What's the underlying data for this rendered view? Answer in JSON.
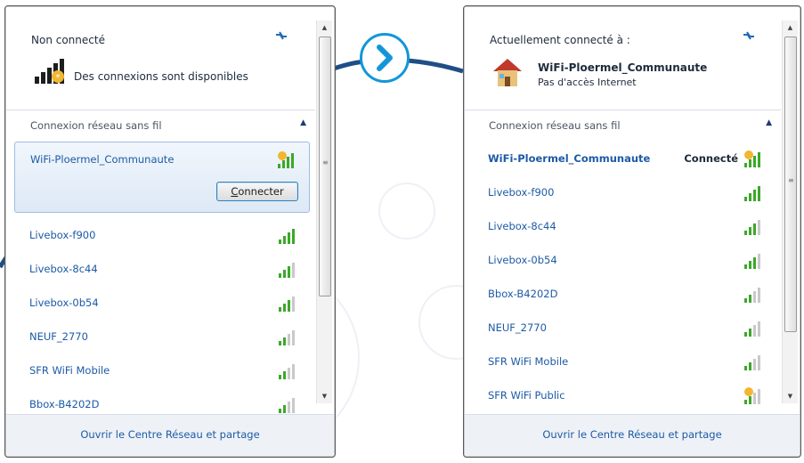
{
  "colors": {
    "accent": "#1396d8",
    "connector": "#1f4e86",
    "link": "#1d5aa6",
    "text": "#1e2b3c"
  },
  "left": {
    "status_title": "Non connecté",
    "status_message": "Des connexions sont disponibles",
    "section_label": "Connexion réseau sans fil",
    "selected_network": "WiFi-Ploermel_Communaute",
    "connect_button_letter": "C",
    "connect_button_rest": "onnecter",
    "networks": [
      "Livebox-f900",
      "Livebox-8c44",
      "Livebox-0b54",
      "NEUF_2770",
      "SFR WiFi Mobile",
      "Bbox-B4202D"
    ],
    "footer_link": "Ouvrir le Centre Réseau et partage"
  },
  "right": {
    "status_title": "Actuellement connecté à :",
    "connected_network": "WiFi-Ploermel_Communaute",
    "internet_status": "Pas d'accès Internet",
    "section_label": "Connexion réseau sans fil",
    "current_network": "WiFi-Ploermel_Communaute",
    "connected_label": "Connecté",
    "networks": [
      "Livebox-f900",
      "Livebox-8c44",
      "Livebox-0b54",
      "Bbox-B4202D",
      "NEUF_2770",
      "SFR WiFi Mobile",
      "SFR WiFi Public"
    ],
    "footer_link": "Ouvrir le Centre Réseau et partage"
  },
  "icons": {
    "refresh": "refresh-icon",
    "signal": "wifi-signal-icon",
    "secured_signal": "wifi-secured-signal-icon",
    "network_home": "home-network-icon",
    "available": "networks-available-icon",
    "next": "chevron-right-icon"
  }
}
